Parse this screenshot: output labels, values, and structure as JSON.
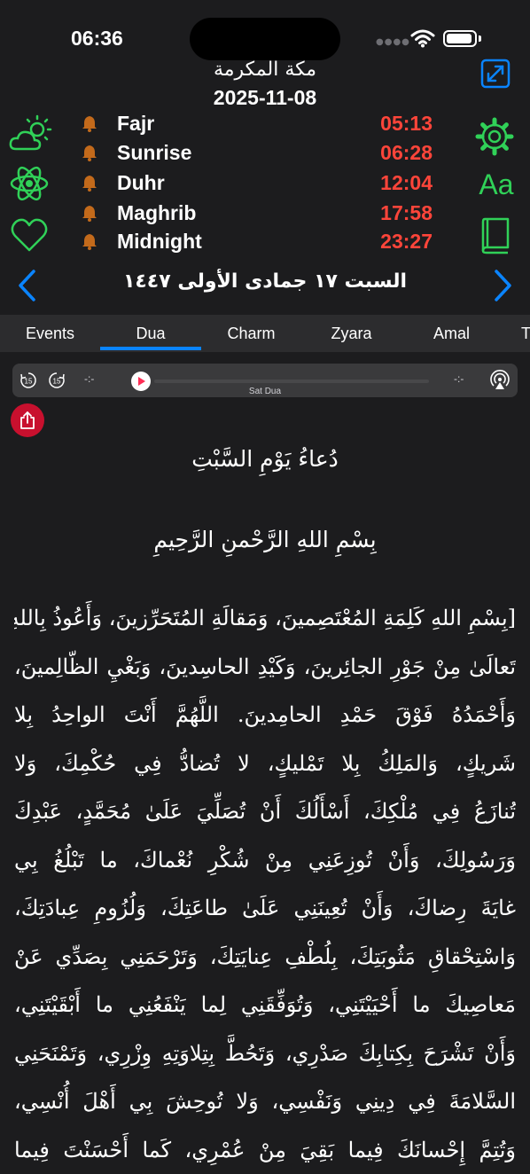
{
  "status_bar": {
    "time": "06:36"
  },
  "header": {
    "city": "مكة المكرمة",
    "gregorian_date": "2025-11-08",
    "hijri_date": "السبت ١٧ جمادى الأولى ١٤٤٧"
  },
  "prayers": [
    {
      "name": "Fajr",
      "time": "05:13"
    },
    {
      "name": "Sunrise",
      "time": "06:28"
    },
    {
      "name": "Duhr",
      "time": "12:04"
    },
    {
      "name": "Maghrib",
      "time": "17:58"
    },
    {
      "name": "Midnight",
      "time": "23:27"
    }
  ],
  "left_icons": [
    "weather-icon",
    "atom-icon",
    "heart-icon"
  ],
  "right_icons": [
    "expand-icon",
    "gear-icon",
    "font-size-icon",
    "book-icon"
  ],
  "font_icon_label": "Aa",
  "tabs": [
    {
      "label": "Events",
      "active": false
    },
    {
      "label": "Dua",
      "active": true
    },
    {
      "label": "Charm",
      "active": false
    },
    {
      "label": "Zyara",
      "active": false
    },
    {
      "label": "Amal",
      "active": false
    },
    {
      "label": "T",
      "active": false
    }
  ],
  "player": {
    "elapsed": "-:-",
    "remaining": "-:-",
    "title": "Sat Dua",
    "skip_back_label": "15",
    "skip_forward_label": "15"
  },
  "dua": {
    "title": "دُعاءُ يَوْمِ السَّبْتِ",
    "bismillah": "بِسْمِ اللهِ الرَّحْمنِ الرَّحِيمِ",
    "lines": [
      "[بِسْمِ اللهِ كَلِمَةِ المُعْتَصِمينَ، وَمَقالَةِ المُتَحَرِّزينَ، وَأَعُوذُ بِاللهِ",
      "تَعالَىٰ مِنْ جَوْرِ الجائِرينَ، وَكَيْدِ الحاسِدينَ، وَبَغْيِ الظّالِمينَ،",
      "وَأَحْمَدُهُ فَوْقَ حَمْدِ الحامِدينَ. اللَّهُمَّ أَنْتَ الواحِدُ بِلا",
      "شَريكٍ، وَالمَلِكُ بِلا تَمْليكٍ، لا تُضادُّ فِي حُكْمِكَ، وَلا",
      "تُنازَعُ فِي مُلْكِكَ، أَسْأَلُكَ أَنْ تُصَلِّيَ عَلَىٰ مُحَمَّدٍ، عَبْدِكَ",
      "وَرَسُولِكَ، وَأَنْ تُوزِعَنِي مِنْ شُكْرِ نُعْماكَ، ما تَبْلُغُ بِي",
      "غايَةَ رِضاكَ، وَأَنْ تُعِينَنِي عَلَىٰ طاعَتِكَ، وَلُزُومِ عِبادَتِكَ،",
      "وَاسْتِحْقاقِ مَثُوبَتِكَ، بِلُطْفِ عِنايَتِكَ، وَتَرْحَمَنِي بِصَدِّي عَنْ",
      "مَعاصِيكَ ما أَحْيَيْتَنِي، وَتُوَفِّقَنِي لِما يَنْفَعُنِي ما أَبْقَيْتَنِي،",
      "وَأَنْ تَشْرَحَ بِكِتابِكَ صَدْرِي، وَتَحُطَّ بِتِلاوَتِهِ وِزْرِي، وَتَمْنَحَنِي",
      "السَّلامَةَ فِي دِينِي وَنَفْسِي، وَلا تُوحِشَ بِي أَهْلَ أُنْسِي،",
      "وَتُتِمَّ إِحْسانَكَ فِيما بَقِيَ مِنْ عُمْرِي، كَما أَحْسَنْتَ فِيما"
    ]
  }
}
